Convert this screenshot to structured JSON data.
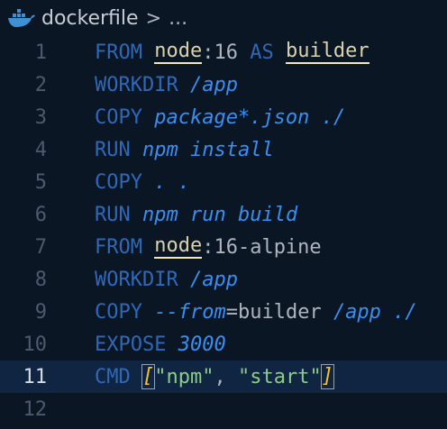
{
  "breadcrumb": {
    "icon": "docker-whale-icon",
    "file": "dockerfile",
    "separator": ">",
    "more": "..."
  },
  "colors": {
    "background": "#0b1624",
    "keyword": "#2f68b8",
    "argument": "#3a8ef0",
    "image_name": "#d9d2ae",
    "string": "#8dcb8a",
    "bracket": "#f4c430",
    "current_line": "#0f2542"
  },
  "editor": {
    "current_line": 11,
    "lines": [
      {
        "number": "1",
        "tokens": [
          {
            "t": "FROM",
            "c": "kw"
          },
          {
            "t": " ",
            "c": "plain"
          },
          {
            "t": "node",
            "c": "img"
          },
          {
            "t": ":16",
            "c": "plain"
          },
          {
            "t": " AS ",
            "c": "kw"
          },
          {
            "t": "builder",
            "c": "img"
          }
        ]
      },
      {
        "number": "2",
        "tokens": [
          {
            "t": "WORKDIR",
            "c": "kw"
          },
          {
            "t": " ",
            "c": "plain"
          },
          {
            "t": "/app",
            "c": "it"
          }
        ]
      },
      {
        "number": "3",
        "tokens": [
          {
            "t": "COPY",
            "c": "kw"
          },
          {
            "t": " ",
            "c": "plain"
          },
          {
            "t": "package*.json ./",
            "c": "it"
          }
        ]
      },
      {
        "number": "4",
        "tokens": [
          {
            "t": "RUN",
            "c": "kw"
          },
          {
            "t": " ",
            "c": "plain"
          },
          {
            "t": "npm install",
            "c": "it"
          }
        ]
      },
      {
        "number": "5",
        "tokens": [
          {
            "t": "COPY",
            "c": "kw"
          },
          {
            "t": " ",
            "c": "plain"
          },
          {
            "t": ". .",
            "c": "it"
          }
        ]
      },
      {
        "number": "6",
        "tokens": [
          {
            "t": "RUN",
            "c": "kw"
          },
          {
            "t": " ",
            "c": "plain"
          },
          {
            "t": "npm run build",
            "c": "it"
          }
        ]
      },
      {
        "number": "7",
        "tokens": [
          {
            "t": "FROM",
            "c": "kw"
          },
          {
            "t": " ",
            "c": "plain"
          },
          {
            "t": "node",
            "c": "img"
          },
          {
            "t": ":16-alpine",
            "c": "plain"
          }
        ]
      },
      {
        "number": "8",
        "tokens": [
          {
            "t": "WORKDIR",
            "c": "kw"
          },
          {
            "t": " ",
            "c": "plain"
          },
          {
            "t": "/app",
            "c": "it"
          }
        ]
      },
      {
        "number": "9",
        "tokens": [
          {
            "t": "COPY",
            "c": "kw"
          },
          {
            "t": " ",
            "c": "plain"
          },
          {
            "t": "--from",
            "c": "it"
          },
          {
            "t": "=builder ",
            "c": "plain"
          },
          {
            "t": "/app ./",
            "c": "it"
          }
        ]
      },
      {
        "number": "10",
        "tokens": [
          {
            "t": "EXPOSE",
            "c": "kw"
          },
          {
            "t": " ",
            "c": "plain"
          },
          {
            "t": "3000",
            "c": "it"
          }
        ]
      },
      {
        "number": "11",
        "tokens": [
          {
            "t": "CMD",
            "c": "kw"
          },
          {
            "t": " ",
            "c": "plain"
          },
          {
            "t": "[",
            "c": "br"
          },
          {
            "t": "\"npm\"",
            "c": "str"
          },
          {
            "t": ", ",
            "c": "plain"
          },
          {
            "t": "\"start\"",
            "c": "str"
          },
          {
            "t": "]",
            "c": "br"
          }
        ]
      },
      {
        "number": "12",
        "tokens": []
      }
    ]
  }
}
